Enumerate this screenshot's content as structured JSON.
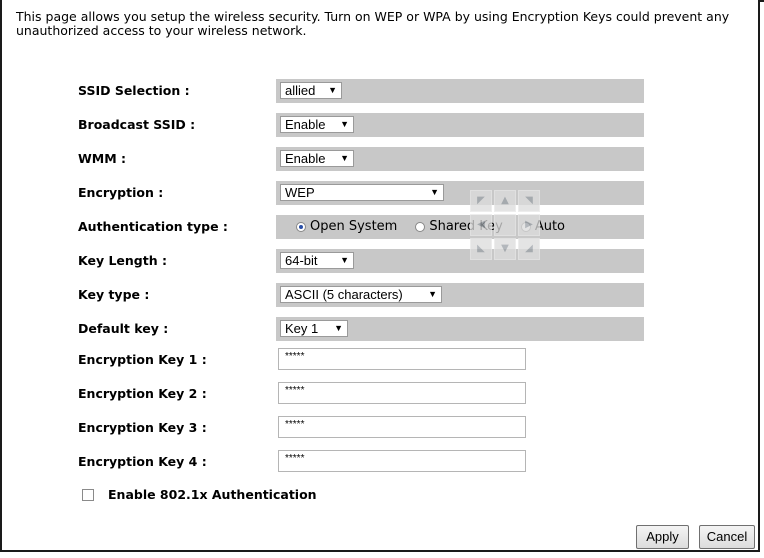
{
  "intro": "This page allows you setup the wireless security. Turn on WEP or WPA by using Encryption Keys could prevent any unauthorized access to your wireless network.",
  "rows": {
    "ssid": {
      "label": "SSID Selection :",
      "value": "allied"
    },
    "broadcast": {
      "label": "Broadcast SSID :",
      "value": "Enable"
    },
    "wmm": {
      "label": "WMM :",
      "value": "Enable"
    },
    "encryption": {
      "label": "Encryption :",
      "value": "WEP"
    },
    "auth": {
      "label": "Authentication type :",
      "options": [
        "Open System",
        "Shared Key",
        "Auto"
      ],
      "selected": "Open System"
    },
    "keylength": {
      "label": "Key Length :",
      "value": "64-bit"
    },
    "keytype": {
      "label": "Key type :",
      "value": "ASCII (5 characters)"
    },
    "defaultkey": {
      "label": "Default key :",
      "value": "Key 1"
    },
    "key1": {
      "label": "Encryption Key 1 :",
      "value": "*****"
    },
    "key2": {
      "label": "Encryption Key 2 :",
      "value": "*****"
    },
    "key3": {
      "label": "Encryption Key 3 :",
      "value": "*****"
    },
    "key4": {
      "label": "Encryption Key 4 :",
      "value": "*****"
    }
  },
  "checkbox": {
    "label": "Enable 802.1x Authentication",
    "checked": false
  },
  "buttons": {
    "apply": "Apply",
    "cancel": "Cancel"
  },
  "icons": {
    "dropdown": "chevron-down-icon",
    "pan": "pan-control-icon"
  }
}
